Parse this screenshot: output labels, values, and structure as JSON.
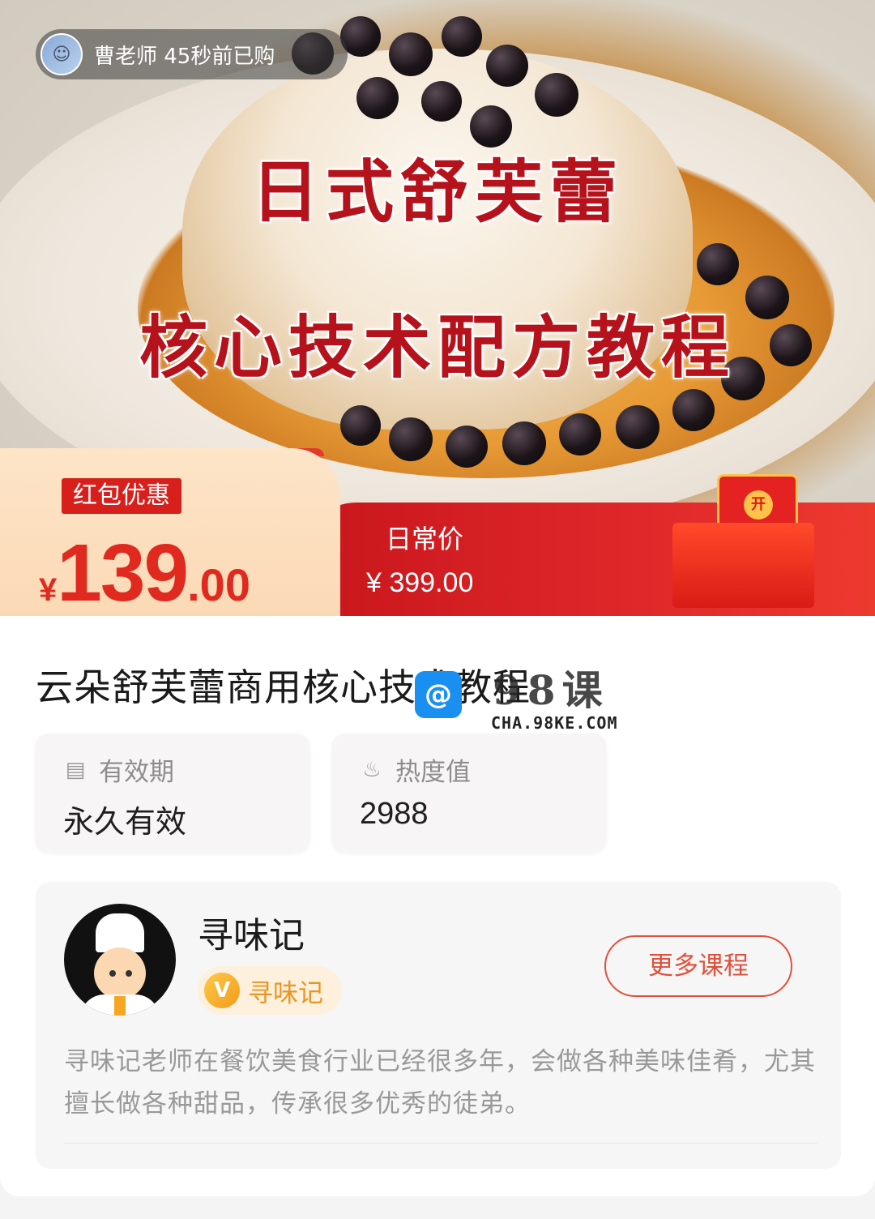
{
  "hero": {
    "buyer_notice": "曹老师 45秒前已购",
    "title_line1": "日式舒芙蕾",
    "title_line2": "核心技术配方教程"
  },
  "price": {
    "promo_tag": "红包优惠",
    "currency": "¥",
    "promo_int": "139",
    "promo_dec": ".00",
    "regular_label": "日常价",
    "regular_price": "¥ 399.00",
    "gift_glyph": "开"
  },
  "course": {
    "title": "云朵舒芙蕾商用核心技术教程"
  },
  "watermark": {
    "big": "98课",
    "small": "CHA.98KE.COM"
  },
  "stats": [
    {
      "label": "有效期",
      "value": "永久有效",
      "icon": "calendar-icon"
    },
    {
      "label": "热度值",
      "value": "2988",
      "icon": "fire-icon"
    }
  ],
  "teacher": {
    "name": "寻味记",
    "badge": "寻味记",
    "more_button": "更多课程",
    "description": "寻味记老师在餐饮美食行业已经很多年，会做各种美味佳肴，尤其擅长做各种甜品，传承很多优秀的徒弟。"
  },
  "colors": {
    "accent_red": "#e02a1f",
    "badge_orange": "#e89623",
    "button_border": "#e0503c"
  }
}
